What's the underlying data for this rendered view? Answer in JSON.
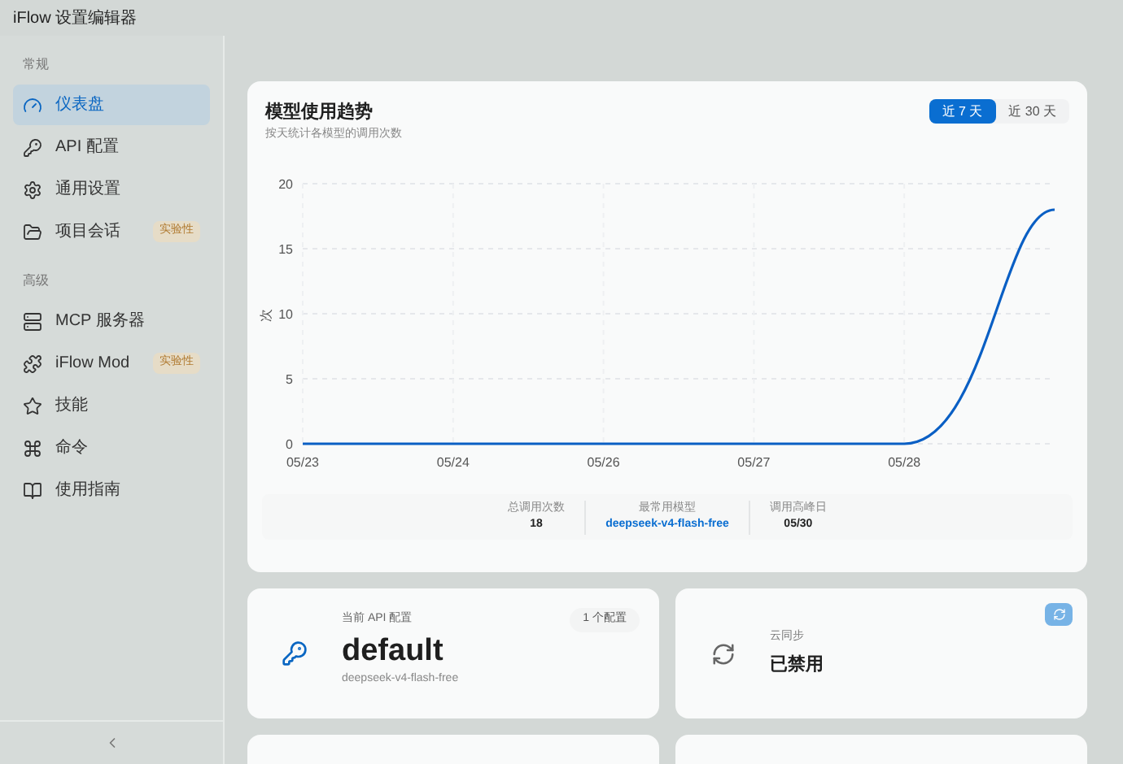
{
  "window": {
    "title": "iFlow 设置编辑器"
  },
  "sidebar": {
    "groups": [
      {
        "label": "常规",
        "items": [
          {
            "label": "仪表盘",
            "selected": true
          },
          {
            "label": "API 配置",
            "selected": false
          },
          {
            "label": "通用设置",
            "selected": false
          },
          {
            "label": "项目会话",
            "selected": false,
            "badge": "实验性"
          }
        ]
      },
      {
        "label": "高级",
        "items": [
          {
            "label": "MCP 服务器",
            "selected": false
          },
          {
            "label": "iFlow Mod",
            "selected": false,
            "badge": "实验性"
          },
          {
            "label": "技能",
            "selected": false
          },
          {
            "label": "命令",
            "selected": false
          },
          {
            "label": "使用指南",
            "selected": false
          }
        ]
      }
    ]
  },
  "trend": {
    "title": "模型使用趋势",
    "subtitle": "按天统计各模型的调用次数",
    "ranges": [
      {
        "label": "近 7 天",
        "selected": true
      },
      {
        "label": "近 30 天",
        "selected": false
      }
    ],
    "chart_data": {
      "type": "line",
      "ylabel": "次",
      "grid": true,
      "categories": [
        "05/23",
        "05/24",
        "05/26",
        "05/27",
        "05/28",
        null
      ],
      "series": [
        {
          "color": "#0a5fc4",
          "values": [
            0,
            0,
            0,
            0,
            0,
            18
          ]
        }
      ],
      "ylim": [
        0,
        20
      ],
      "yticks": [
        0,
        5,
        10,
        15,
        20
      ]
    },
    "stats": [
      {
        "label": "总调用次数",
        "value": "18",
        "kind": "plain"
      },
      {
        "label": "最常用模型",
        "value": "deepseek-v4-flash-free",
        "kind": "link"
      },
      {
        "label": "调用高峰日",
        "value": "05/30",
        "kind": "plain"
      }
    ]
  },
  "api_card": {
    "label": "当前 API 配置",
    "badge": "1 个配置",
    "name": "default",
    "model": "deepseek-v4-flash-free"
  },
  "sync_card": {
    "label": "云同步",
    "status": "已禁用"
  }
}
